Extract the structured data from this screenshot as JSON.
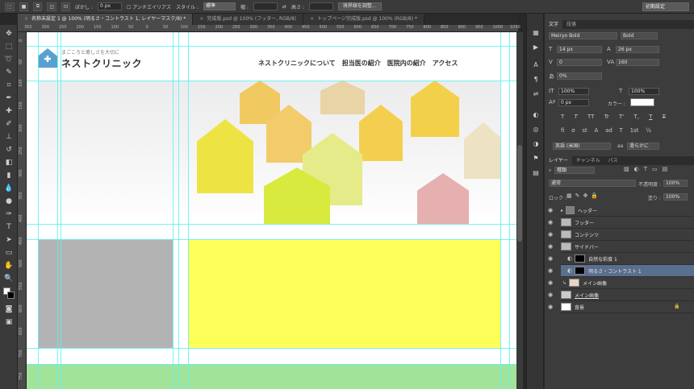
{
  "options_bar": {
    "feather_label": "ぼかし :",
    "feather_value": "0 px",
    "antialias_label": "アンチエイリアス",
    "style_label": "スタイル :",
    "style_value": "標準",
    "width_label": "幅 :",
    "height_label": "高さ :",
    "refine_button": "境界線を調整...",
    "workspace": "初期設定"
  },
  "tabs": [
    {
      "label": "名称未設定 1 @ 100% (明るさ・コントラスト 1, レイヤーマスク/8) *",
      "active": true
    },
    {
      "label": "完成版.psd @ 100% (フッター, RGB/8)",
      "active": false
    },
    {
      "label": "トップページ完成版.psd @ 100% (RGB/8) *",
      "active": false
    }
  ],
  "ruler_top": [
    "350",
    "300",
    "250",
    "200",
    "150",
    "100",
    "50",
    "0",
    "50",
    "100",
    "150",
    "200",
    "250",
    "300",
    "350",
    "400",
    "450",
    "500",
    "550",
    "600",
    "650",
    "700",
    "750",
    "800",
    "850",
    "900",
    "950",
    "1000",
    "1050"
  ],
  "ruler_left": [
    "0",
    "50",
    "100",
    "150",
    "200",
    "250",
    "300",
    "350",
    "400",
    "450",
    "500",
    "550",
    "600",
    "650",
    "700",
    "750"
  ],
  "document": {
    "tagline": "まごころと癒しさを大切に",
    "clinic_name": "ネストクリニック",
    "nav": [
      "ネストクリニックについて",
      "担当医の紹介",
      "医院内の紹介",
      "アクセス"
    ],
    "colors": {
      "sidebar": "#b3b3b3",
      "content": "#ffff5a",
      "footer": "#a2e39a",
      "logo": "#5aa0cf",
      "guide": "#5ef2f2"
    }
  },
  "character_panel": {
    "tabs": [
      "文字",
      "段落"
    ],
    "font_family": "Meiryo Bold",
    "font_style": "Bold",
    "font_size": "14 px",
    "leading": "26 px",
    "kerning": "0",
    "tracking": "160",
    "tsume": "0%",
    "vertical_scale": "100%",
    "horizontal_scale": "100%",
    "baseline": "0 px",
    "color_label": "カラー :",
    "type_buttons": [
      "T",
      "T",
      "TT",
      "Tr",
      "T'",
      "T,",
      "T",
      "T"
    ],
    "ot_buttons": [
      "fi",
      "σ",
      "st",
      "A",
      "ad",
      "T",
      "1st",
      "½"
    ],
    "language": "英語 (米国)",
    "aa_label": "aa",
    "antialias": "滑らかに"
  },
  "layers_panel": {
    "tabs": [
      "レイヤー",
      "チャンネル",
      "パス"
    ],
    "filter": "種類",
    "blend_mode": "通常",
    "opacity_label": "不透明度 :",
    "opacity": "100%",
    "lock_label": "ロック :",
    "fill_label": "塗り :",
    "fill": "100%",
    "layers": [
      {
        "name": "ヘッダー",
        "type": "group",
        "selected": false,
        "underline": false
      },
      {
        "name": "フッター",
        "type": "group",
        "selected": false,
        "underline": false
      },
      {
        "name": "コンテンツ",
        "type": "group",
        "selected": false,
        "underline": false
      },
      {
        "name": "サイドバー",
        "type": "group",
        "selected": false,
        "underline": false
      },
      {
        "name": "自然な彩度 1",
        "type": "adjustment",
        "selected": false,
        "underline": false
      },
      {
        "name": "明るさ・コントラスト 1",
        "type": "adjustment",
        "selected": true,
        "underline": false
      },
      {
        "name": "メイン画像",
        "type": "image",
        "selected": false,
        "underline": false
      },
      {
        "name": "メイン画像",
        "type": "image",
        "selected": false,
        "underline": true
      },
      {
        "name": "背景",
        "type": "background",
        "selected": false,
        "underline": false
      }
    ]
  }
}
